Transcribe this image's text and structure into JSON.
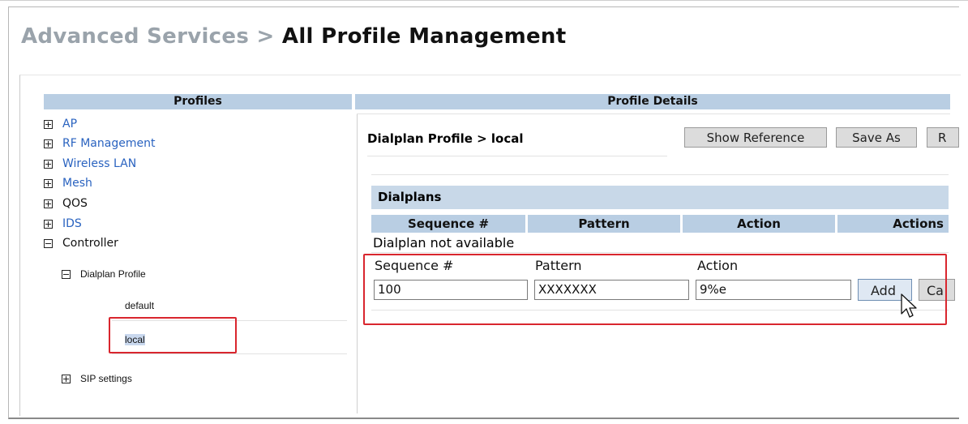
{
  "breadcrumb": {
    "parent": "Advanced Services >",
    "current": "All Profile Management"
  },
  "left": {
    "header": "Profiles",
    "tree": [
      {
        "label": "AP",
        "state": "plus",
        "style": "link"
      },
      {
        "label": "RF Management",
        "state": "plus",
        "style": "link"
      },
      {
        "label": "Wireless LAN",
        "state": "plus",
        "style": "link"
      },
      {
        "label": "Mesh",
        "state": "plus",
        "style": "link"
      },
      {
        "label": "QOS",
        "state": "plus",
        "style": "plain"
      },
      {
        "label": "IDS",
        "state": "plus",
        "style": "link"
      },
      {
        "label": "Controller",
        "state": "minus",
        "style": "plain"
      }
    ],
    "dialplan_profile": "Dialplan Profile",
    "profiles": [
      "default",
      "local"
    ],
    "sip_settings": "SIP settings"
  },
  "right": {
    "header": "Profile Details",
    "profile_title": "Dialplan Profile > local",
    "buttons": {
      "show_reference": "Show Reference",
      "save_as": "Save As",
      "reset": "R"
    },
    "section": "Dialplans",
    "columns": [
      "Sequence #",
      "Pattern",
      "Action",
      "Actions"
    ],
    "empty_message": "Dialplan not available",
    "form": {
      "labels": {
        "sequence": "Sequence #",
        "pattern": "Pattern",
        "action": "Action"
      },
      "values": {
        "sequence": "100",
        "pattern": "XXXXXXX",
        "action": "9%e"
      },
      "add": "Add",
      "cancel": "Ca"
    }
  },
  "colors": {
    "header_bg": "#b9cee3",
    "section_bg": "#c8d8e8",
    "link": "#2a63c0",
    "highlight": "#d9262e"
  }
}
